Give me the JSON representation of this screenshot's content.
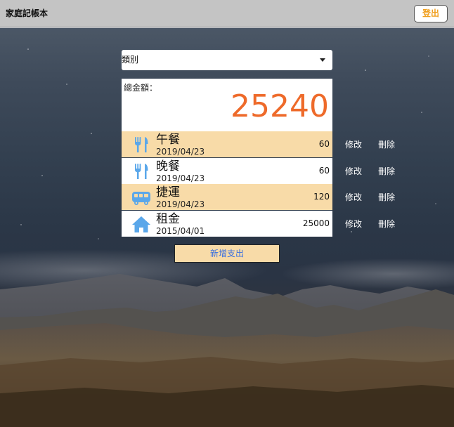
{
  "app": {
    "title": "家庭記帳本",
    "logout_label": "登出"
  },
  "filter": {
    "category_value": "類別"
  },
  "summary": {
    "total_label": "總金額：",
    "total_value": "25240"
  },
  "expenses": [
    {
      "title": "午餐",
      "date": "2019/04/23",
      "amount": "60",
      "icon": "utensils-icon",
      "edit_label": "修改",
      "delete_label": "刪除"
    },
    {
      "title": "晚餐",
      "date": "2019/04/23",
      "amount": "60",
      "icon": "utensils-icon",
      "edit_label": "修改",
      "delete_label": "刪除"
    },
    {
      "title": "捷運",
      "date": "2019/04/23",
      "amount": "120",
      "icon": "bus-icon",
      "edit_label": "修改",
      "delete_label": "刪除"
    },
    {
      "title": "租金",
      "date": "2015/04/01",
      "amount": "25000",
      "icon": "home-icon",
      "edit_label": "修改",
      "delete_label": "刪除"
    }
  ],
  "add_button_label": "新增支出",
  "colors": {
    "accent_orange": "#ee6a2a",
    "row_highlight": "#f8dba8",
    "icon_blue": "#5aa7ea",
    "logout_text": "#f0a020",
    "add_button_text": "#3a6fe0"
  }
}
